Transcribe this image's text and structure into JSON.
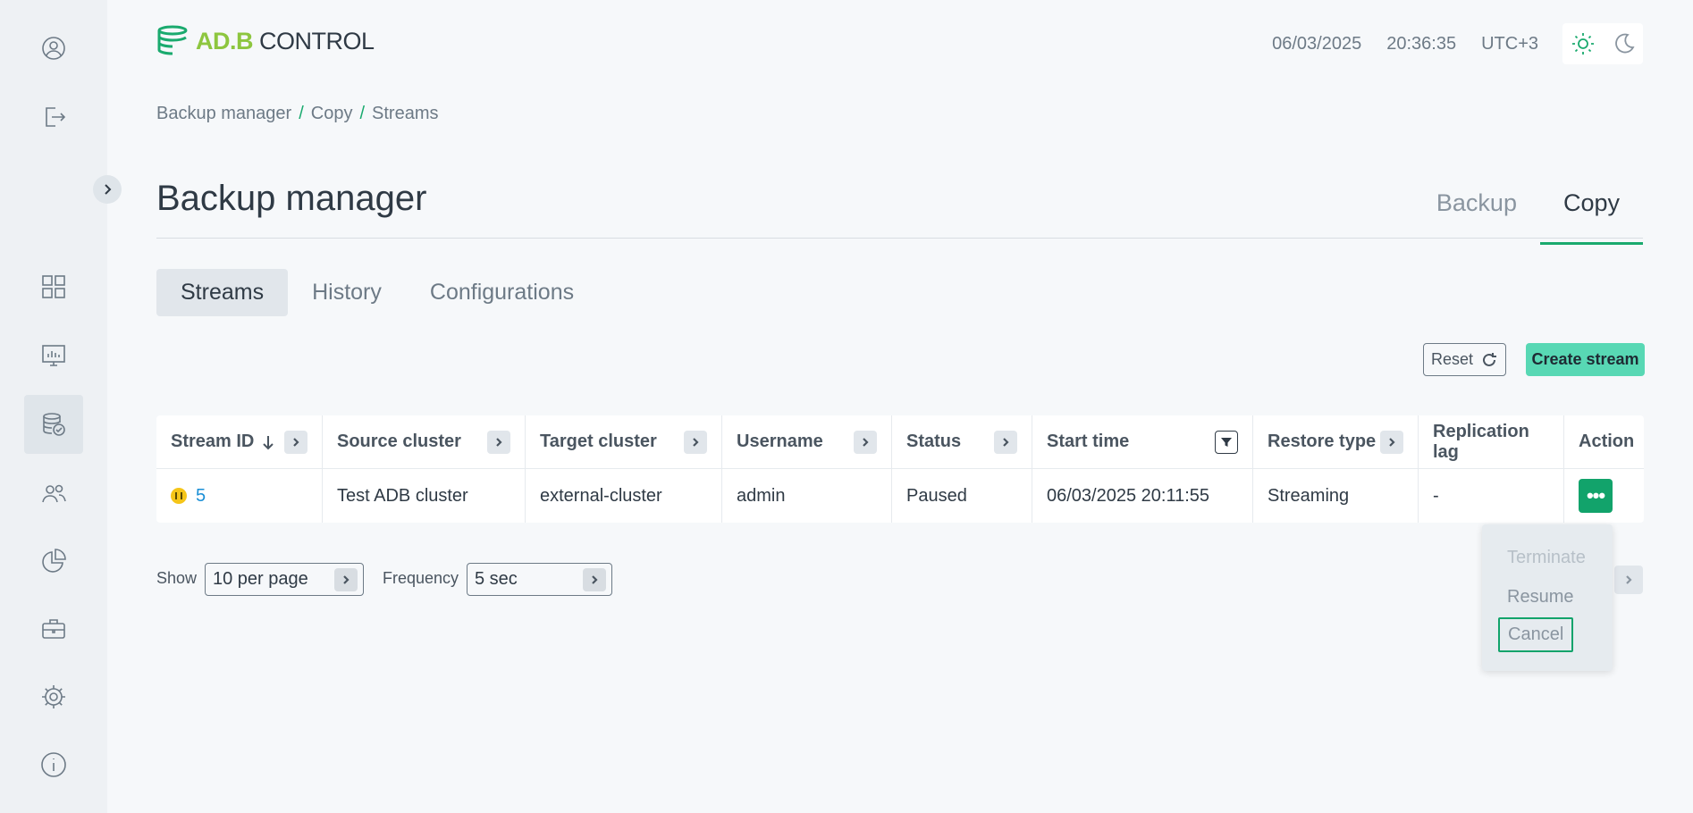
{
  "header": {
    "logo_prefix": "AD.B",
    "logo_suffix": "CONTROL",
    "date": "06/03/2025",
    "time": "20:36:35",
    "timezone": "UTC+3"
  },
  "sidebar": {
    "items": [
      {
        "icon": "user-circle-icon"
      },
      {
        "icon": "logout-icon"
      },
      {
        "icon": "grid-icon"
      },
      {
        "icon": "monitor-chart-icon"
      },
      {
        "icon": "backup-database-icon",
        "active": true
      },
      {
        "icon": "users-icon"
      },
      {
        "icon": "pie-chart-icon"
      },
      {
        "icon": "briefcase-icon"
      },
      {
        "icon": "gear-icon"
      },
      {
        "icon": "info-icon"
      }
    ]
  },
  "breadcrumb": [
    "Backup manager",
    "Copy",
    "Streams"
  ],
  "page": {
    "title": "Backup manager",
    "top_tabs": [
      {
        "label": "Backup",
        "active": false
      },
      {
        "label": "Copy",
        "active": true
      }
    ],
    "sub_tabs": [
      {
        "label": "Streams",
        "active": true
      },
      {
        "label": "History",
        "active": false
      },
      {
        "label": "Configurations",
        "active": false
      }
    ]
  },
  "toolbar": {
    "reset_label": "Reset",
    "create_label": "Create stream"
  },
  "table": {
    "columns": [
      "Stream ID",
      "Source cluster",
      "Target cluster",
      "Username",
      "Status",
      "Start time",
      "Restore type",
      "Replication lag",
      "Action"
    ],
    "rows": [
      {
        "stream_id": "5",
        "source_cluster": "Test ADB cluster",
        "target_cluster": "external-cluster",
        "username": "admin",
        "status": "Paused",
        "start_time": "06/03/2025 20:11:55",
        "restore_type": "Streaming",
        "replication_lag": "-",
        "action": "•••"
      }
    ]
  },
  "pagination": {
    "show_label": "Show",
    "per_page": "10 per page",
    "frequency_label": "Frequency",
    "frequency": "5 sec"
  },
  "action_menu": {
    "items": [
      {
        "label": "Terminate",
        "disabled": true
      },
      {
        "label": "Resume",
        "disabled": false
      },
      {
        "label": "Cancel",
        "disabled": false,
        "focused": true
      }
    ]
  },
  "colors": {
    "accent": "#1aaa6e",
    "create_button": "#58d8b4",
    "action_button": "#12a36b",
    "paused_status": "#f5c518"
  }
}
